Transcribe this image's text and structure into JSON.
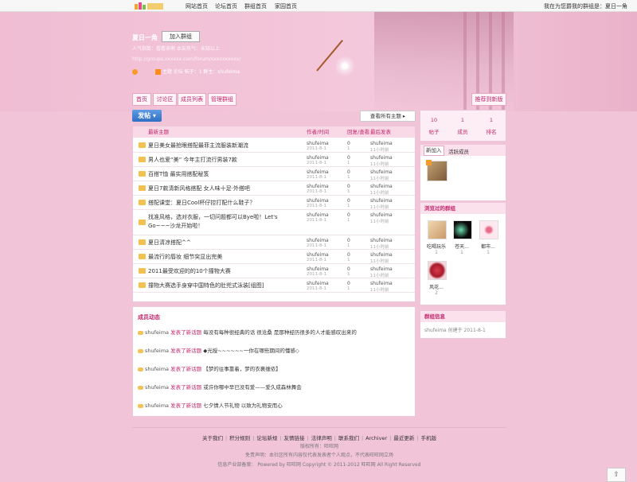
{
  "topnav": {
    "items": [
      "网站首页",
      "论坛首页",
      "群组首页",
      "家园首页"
    ],
    "right_text": "我在为您爵我的群组是：夏日一角"
  },
  "header": {
    "title": "夏日一角",
    "join_label": "加入群组",
    "meta": "人气指数：看看来啊  本友热气：未知以上",
    "url": "http://groups.xxxxxx.com/forum/xxxxxxxxxx/",
    "stats": "  主题      论坛   帖子：1    群主：shufeima"
  },
  "tabs": [
    "首页",
    "讨论区",
    "成员列表",
    "管理群组"
  ],
  "recommend_label": "推荐到新版",
  "post_label": "发帖",
  "view_all_label": "查看所有主题",
  "topics": {
    "headers": {
      "title": "最新主题",
      "author": "作者/时间",
      "replies": "回复/查看",
      "last": "最后发表"
    },
    "rows": [
      {
        "title": "夏日美女最抢眼搭配最菲主流服装新潮流",
        "author": "shufeima",
        "date": "2011-8-1",
        "replies": "0",
        "views": "1",
        "last": "shufeima",
        "ago": "11小时前"
      },
      {
        "title": "男人也爱“美” 今年主打流行男装7款",
        "author": "shufeima",
        "date": "2011-8-1",
        "replies": "0",
        "views": "1",
        "last": "shufeima",
        "ago": "11小时前"
      },
      {
        "title": "百搭T恤 最实用搭配秘笈",
        "author": "shufeima",
        "date": "2011-8-1",
        "replies": "0",
        "views": "1",
        "last": "shufeima",
        "ago": "11小时前"
      },
      {
        "title": "夏日7款清新风格搭配 女人味十足·外搭吧",
        "author": "shufeima",
        "date": "2011-8-1",
        "replies": "0",
        "views": "1",
        "last": "shufeima",
        "ago": "11小时前"
      },
      {
        "title": "搭配课堂：夏日Cool杯仔控打配什么鞋子？",
        "author": "shufeima",
        "date": "2011-8-1",
        "replies": "0",
        "views": "1",
        "last": "shufeima",
        "ago": "11小时前"
      },
      {
        "title": "找准风格，选对衣服，一切问题都可以Bye啦！Let's Go~~~沙龙开始啦！",
        "author": "shufeima",
        "date": "2011-8-1",
        "replies": "0",
        "views": "1",
        "last": "shufeima",
        "ago": "11小时前"
      },
      {
        "title": "夏日清凉搭配^^",
        "author": "shufeima",
        "date": "2011-8-1",
        "replies": "0",
        "views": "1",
        "last": "shufeima",
        "ago": "11小时前"
      },
      {
        "title": "最流行的唇妆 细节突显出完美",
        "author": "shufeima",
        "date": "2011-8-1",
        "replies": "0",
        "views": "1",
        "last": "shufeima",
        "ago": "11小时前"
      },
      {
        "title": "2011最受欢迎的的10个撞物大赛",
        "author": "shufeima",
        "date": "2011-8-1",
        "replies": "0",
        "views": "1",
        "last": "shufeima",
        "ago": "11小时前"
      },
      {
        "title": "撞物大赛选手身穿中国特色的肚兜式泳装[组图]",
        "author": "shufeima",
        "date": "2011-8-1",
        "replies": "0",
        "views": "1",
        "last": "shufeima",
        "ago": "11小时前"
      }
    ]
  },
  "activity": {
    "title": "成员动态",
    "items": [
      {
        "user": "shufeima",
        "verb": "发表了新话题",
        "text": "每没有每种很经典的话 很沧桑 是那种经历很多的人才能感叹出来的"
      },
      {
        "user": "shufeima",
        "verb": "发表了新话题",
        "text": "◆光授~~~~~~一你在哪些期间的懂感◇"
      },
      {
        "user": "shufeima",
        "verb": "发表了新话题",
        "text": "【梦的往事靠着，梦的衣裹缠侬】"
      },
      {
        "user": "shufeima",
        "verb": "发表了新话题",
        "text": "或许你哪中早已没有爱——爱久成森林舞会"
      },
      {
        "user": "shufeima",
        "verb": "发表了新话题",
        "text": "七夕情人节礼物 以致为礼物安而心"
      }
    ]
  },
  "sidebar": {
    "stats": [
      {
        "n": "10",
        "label": "帖子"
      },
      {
        "n": "1",
        "label": "成员"
      },
      {
        "n": "1",
        "label": "排名"
      }
    ],
    "new_tabs": [
      "新加入",
      "活跃成员"
    ],
    "visited_title": "浏览过的群组",
    "visited": [
      {
        "label": "吃喝玩乐",
        "n": "1"
      },
      {
        "label": "苍天...",
        "n": "1"
      },
      {
        "label": "都市...",
        "n": "1"
      },
      {
        "label": "风花...",
        "n": "2"
      }
    ],
    "info_title": "群组信息",
    "info_text": "shufeima 创建于 2011-8-1"
  },
  "footer": {
    "links": [
      "关于我们",
      "积分规则",
      "论坛新规",
      "友情链接",
      "法律声明",
      "联系我们",
      "Archiver",
      "最近更新",
      "手机版"
    ],
    "line2": "版权所有：旺旺网",
    "line3": "免责声明：本社区所有内容仅代表发表者个人观点，不代表旺旺网立场",
    "line4": "信息产业部备案： Powered by 旺旺网 Copyright © 2011-2012 旺旺网 All Right Reserved"
  },
  "colors": {
    "accent": "#c2286d",
    "page_bg": "#f2c4d8",
    "post_button": "#2f6fc4"
  }
}
